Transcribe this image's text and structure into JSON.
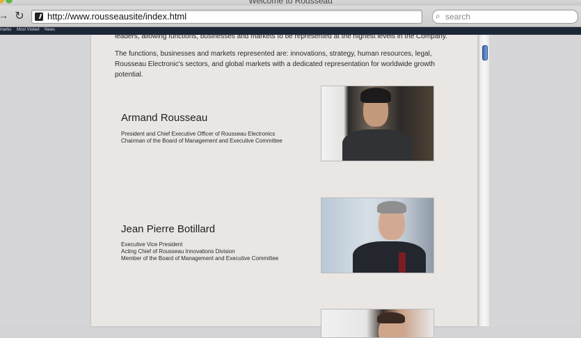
{
  "window": {
    "title": "Welcome to Rousseau"
  },
  "toolbar": {
    "forward_icon": "arrow-right-icon",
    "reload_icon": "reload-icon",
    "url": "http://www.rousseausite/index.html",
    "search_placeholder": "search"
  },
  "bookmarks": [
    {
      "label": "marks"
    },
    {
      "label": "Most Visited"
    },
    {
      "label": "News"
    }
  ],
  "content": {
    "paragraphs": [
      "leaders, allowing functions, businesses and markets to be represented at the highest levels in the Company.",
      "The functions, businesses and markets represented are: innovations, strategy, human resources, legal, Rousseau  Electronic's sectors, and global markets with a dedicated representation for worldwide growth potential."
    ],
    "people": [
      {
        "name": "Armand Rousseau",
        "roles": [
          "President and Chief Executive Officer of Rousseau Electronics",
          "Chairman of the Board of Management and Executive Committee"
        ]
      },
      {
        "name": "Jean Pierre Botillard",
        "roles": [
          "Executive Vice President",
          "Acting Chief of Rousseau Innovations Division",
          "Member of the Board of Management and Executive Committee"
        ]
      }
    ]
  },
  "colors": {
    "page_bg": "#e9e6e4",
    "bookmarks_bar": "#1e2738",
    "scroll_thumb": "#3e63a6"
  }
}
